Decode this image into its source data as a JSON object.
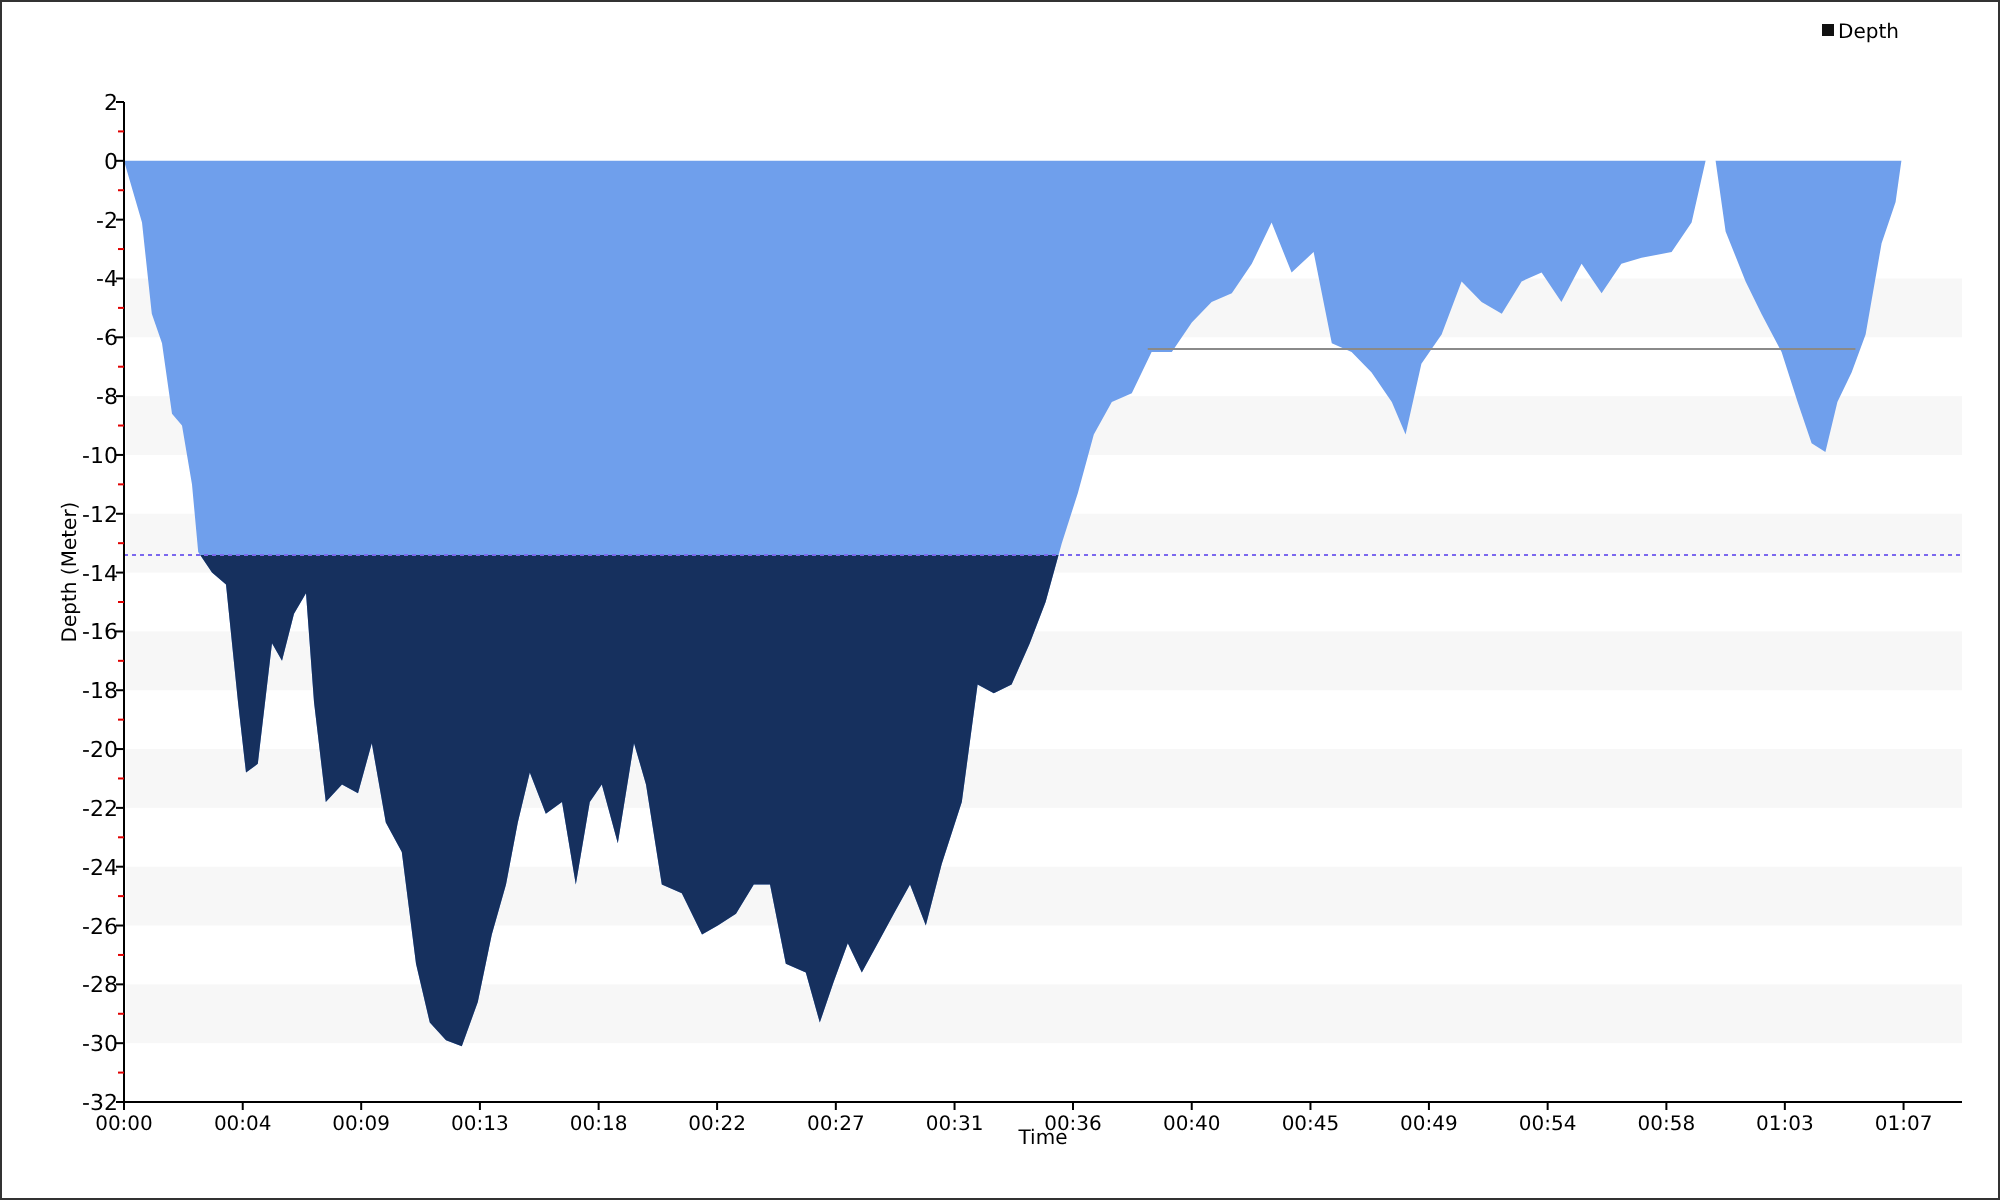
{
  "chart": {
    "chart_data": {
      "type": "area",
      "xlabel": "Time",
      "ylabel": "Depth (Meter)",
      "xlim": [
        0,
        69.2
      ],
      "ylim": [
        -32,
        2
      ],
      "x": [
        0,
        0.68,
        1.05,
        1.43,
        1.81,
        2.18,
        2.56,
        2.79,
        3.31,
        3.84,
        4.29,
        4.59,
        5.04,
        5.57,
        5.95,
        6.4,
        6.85,
        7.15,
        7.6,
        8.21,
        8.81,
        9.33,
        9.86,
        10.46,
        10.99,
        11.51,
        12.12,
        12.72,
        13.32,
        13.85,
        14.38,
        14.83,
        15.28,
        15.88,
        16.49,
        17.01,
        17.54,
        17.99,
        18.59,
        19.2,
        19.65,
        20.25,
        21,
        21.76,
        22.36,
        23.04,
        23.71,
        24.32,
        24.92,
        25.67,
        26.2,
        26.72,
        27.25,
        27.78,
        28.38,
        28.98,
        29.59,
        30.19,
        30.79,
        31.54,
        32.14,
        32.75,
        33.42,
        34.1,
        34.7,
        35.31,
        35.91,
        36.51,
        37.19,
        37.94,
        38.69,
        39.45,
        40.2,
        40.95,
        41.71,
        42.46,
        43.21,
        43.96,
        44.79,
        45.47,
        46.22,
        46.97,
        47.73,
        48.25,
        48.85,
        49.61,
        50.36,
        51.11,
        51.87,
        52.62,
        53.37,
        54.12,
        54.88,
        55.63,
        56.38,
        57.14,
        58.27,
        59.02,
        59.55,
        59.92,
        60.3,
        61.05,
        61.65,
        62.41,
        63.01,
        63.54,
        64.06,
        64.51,
        65.04,
        65.57,
        66.17,
        66.7,
        66.92
      ],
      "series": [
        {
          "name": "Depth",
          "color": "#6f9fec",
          "values": [
            0,
            -2.1,
            -5.2,
            -6.2,
            -8.6,
            -9,
            -11,
            -13.3,
            -14,
            -14.4,
            -18.4,
            -20.8,
            -20.5,
            -16.4,
            -17,
            -15.4,
            -14.7,
            -18.4,
            -21.8,
            -21.2,
            -21.5,
            -19.8,
            -22.5,
            -23.5,
            -27.3,
            -29.3,
            -29.9,
            -30.1,
            -28.6,
            -26.3,
            -24.6,
            -22.5,
            -20.8,
            -22.2,
            -21.8,
            -24.6,
            -21.8,
            -21.2,
            -23.2,
            -19.8,
            -21.2,
            -24.6,
            -24.9,
            -26.3,
            -26,
            -25.6,
            -24.6,
            -24.6,
            -27.3,
            -27.6,
            -29.3,
            -27.9,
            -26.6,
            -27.6,
            -26.6,
            -25.6,
            -24.6,
            -26,
            -23.9,
            -21.8,
            -17.8,
            -18.1,
            -17.8,
            -16.4,
            -15,
            -13,
            -11.3,
            -9.3,
            -8.2,
            -7.9,
            -6.5,
            -6.5,
            -5.5,
            -4.8,
            -4.5,
            -3.5,
            -2.1,
            -3.8,
            -3.1,
            -6.2,
            -6.5,
            -7.2,
            -8.2,
            -9.3,
            -6.9,
            -5.9,
            -4.1,
            -4.8,
            -5.2,
            -4.1,
            -3.8,
            -4.8,
            -3.5,
            -4.5,
            -3.5,
            -3.3,
            -3.1,
            -2.1,
            0,
            0,
            -2.4,
            -4.1,
            -5.2,
            -6.5,
            -8.2,
            -9.6,
            -9.9,
            -8.2,
            -7.2,
            -5.9,
            -2.8,
            -1.4,
            0
          ]
        }
      ],
      "xticks": [
        {
          "value": 0,
          "label": "00:00"
        },
        {
          "value": 4.47,
          "label": "00:04"
        },
        {
          "value": 8.93,
          "label": "00:09"
        },
        {
          "value": 13.4,
          "label": "00:13"
        },
        {
          "value": 17.87,
          "label": "00:18"
        },
        {
          "value": 22.33,
          "label": "00:22"
        },
        {
          "value": 26.8,
          "label": "00:27"
        },
        {
          "value": 31.27,
          "label": "00:31"
        },
        {
          "value": 35.73,
          "label": "00:36"
        },
        {
          "value": 40.2,
          "label": "00:40"
        },
        {
          "value": 44.67,
          "label": "00:45"
        },
        {
          "value": 49.13,
          "label": "00:49"
        },
        {
          "value": 53.6,
          "label": "00:54"
        },
        {
          "value": 58.07,
          "label": "00:58"
        },
        {
          "value": 62.53,
          "label": "01:03"
        },
        {
          "value": 67,
          "label": "01:07"
        }
      ],
      "yticks": [
        2,
        0,
        -2,
        -4,
        -6,
        -8,
        -10,
        -12,
        -14,
        -16,
        -18,
        -20,
        -22,
        -24,
        -26,
        -28,
        -30,
        -32
      ],
      "ref_lines": [
        {
          "axis": "y",
          "value": -13.4,
          "color": "#7b68ee"
        }
      ]
    }
  }
}
